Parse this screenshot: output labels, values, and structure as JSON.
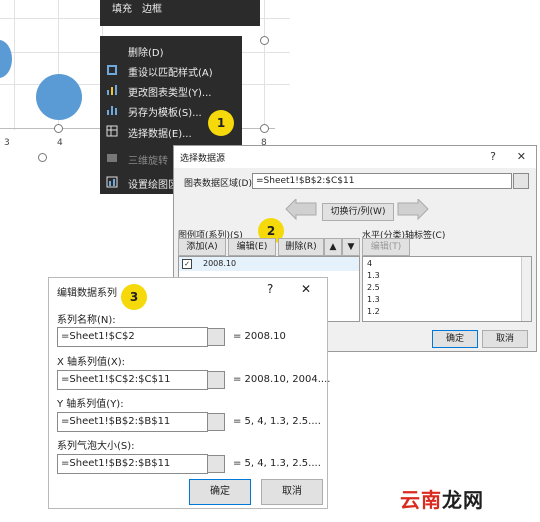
{
  "chart": {
    "x_ticks": [
      "3",
      "4",
      "8"
    ]
  },
  "context_menu": {
    "top_items": [
      "填充",
      "边框"
    ],
    "items": [
      {
        "label": "删除(D)",
        "icon": "none"
      },
      {
        "label": "重设以匹配样式(A)",
        "icon": "reset-style-icon"
      },
      {
        "label": "更改图表类型(Y)...",
        "icon": "chart-type-icon"
      },
      {
        "label": "另存为模板(S)...",
        "icon": "template-icon"
      },
      {
        "label": "选择数据(E)...",
        "icon": "select-data-icon"
      },
      {
        "label": "三维旋转",
        "icon": "3d-rotate-icon"
      },
      {
        "label": "设置绘图区",
        "icon": "format-plot-icon"
      }
    ]
  },
  "badges": {
    "one": "1",
    "two": "2",
    "three": "3"
  },
  "select_source": {
    "title": "选择数据源",
    "help": "?",
    "close": "✕",
    "range_label": "图表数据区域(D):",
    "range_value": "=Sheet1!$B$2:$C$11",
    "switch_label": "切换行/列(W)",
    "series_label": "图例项(系列)(S)",
    "add": "添加(A)",
    "edit": "编辑(E)",
    "remove": "删除(R)",
    "series": [
      "2008.10"
    ],
    "axis_label": "水平(分类)轴标签(C)",
    "axis_edit": "编辑(T)",
    "axis_values": [
      "4",
      "1.3",
      "2.5",
      "1.3",
      "1.2"
    ],
    "ok": "确定",
    "cancel": "取消"
  },
  "edit_series": {
    "title": "编辑数据系列",
    "help": "?",
    "close": "✕",
    "name_label": "系列名称(N):",
    "name_value": "=Sheet1!$C$2",
    "name_preview": "= 2008.10",
    "x_label": "X 轴系列值(X):",
    "x_value": "=Sheet1!$C$2:$C$11",
    "x_preview": "= 2008.10, 2004....",
    "y_label": "Y 轴系列值(Y):",
    "y_value": "=Sheet1!$B$2:$B$11",
    "y_preview": "= 5, 4, 1.3, 2.5....",
    "size_label": "系列气泡大小(S):",
    "size_value": "=Sheet1!$B$2:$B$11",
    "size_preview": "= 5, 4, 1.3, 2.5....",
    "ok": "确定",
    "cancel": "取消"
  },
  "watermark": {
    "part1": "云南",
    "part2": "龙网"
  }
}
